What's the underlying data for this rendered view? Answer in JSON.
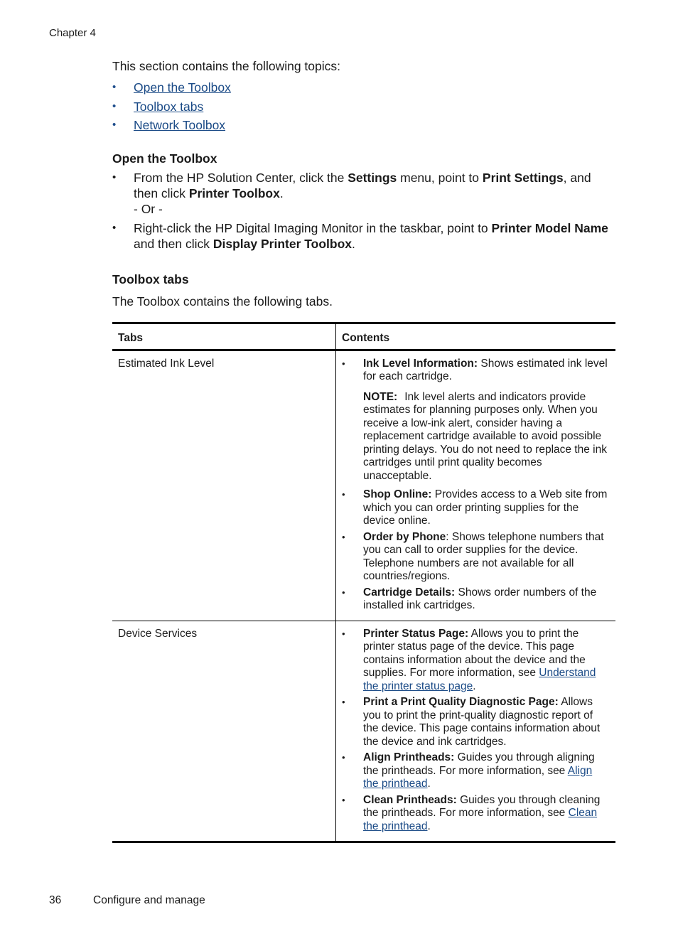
{
  "header": {
    "chapter": "Chapter 4"
  },
  "intro": "This section contains the following topics:",
  "topics": [
    "Open the Toolbox",
    "Toolbox tabs",
    "Network Toolbox"
  ],
  "bullet_char": "•",
  "open_toolbox": {
    "heading": "Open the Toolbox",
    "step1": {
      "t1": "From the HP Solution Center, click the ",
      "b1": "Settings",
      "t2": " menu, point to ",
      "b2": "Print Settings",
      "t3": ", and then click ",
      "b3": "Printer Toolbox",
      "t4": "."
    },
    "or": "- Or -",
    "step2": {
      "t1": "Right-click the HP Digital Imaging Monitor in the taskbar, point to ",
      "b1": "Printer Model Name",
      "t2": " and then click ",
      "b2": "Display Printer Toolbox",
      "t3": "."
    }
  },
  "toolbox_tabs": {
    "heading": "Toolbox tabs",
    "intro": "The Toolbox contains the following tabs.",
    "table": {
      "headers": [
        "Tabs",
        "Contents"
      ],
      "rows": [
        {
          "tab": "Estimated Ink Level",
          "items": [
            {
              "label": "Ink Level Information:",
              "text": " Shows estimated ink level for each cartridge."
            },
            {
              "label": "Shop Online:",
              "text": " Provides access to a Web site from which you can order printing supplies for the device online."
            },
            {
              "label": "Order by Phone",
              "text": ": Shows telephone numbers that you can call to order supplies for the device. Telephone numbers are not available for all countries/regions."
            },
            {
              "label": "Cartridge Details:",
              "text": " Shows order numbers of the installed ink cartridges."
            }
          ],
          "note": {
            "label": "NOTE:",
            "text": "Ink level alerts and indicators provide estimates for planning purposes only. When you receive a low-ink alert, consider having a replacement cartridge available to avoid possible printing delays. You do not need to replace the ink cartridges until print quality becomes unacceptable."
          }
        },
        {
          "tab": "Device Services",
          "items": [
            {
              "label": "Printer Status Page:",
              "text": " Allows you to print the printer status page of the device. This page contains information about the device and the supplies. For more information, see ",
              "link": "Understand the printer status page",
              "end": "."
            },
            {
              "label": "Print a Print Quality Diagnostic Page:",
              "text": " Allows you to print the print-quality diagnostic report of the device. This page contains information about the device and ink cartridges."
            },
            {
              "label": "Align Printheads:",
              "text": " Guides you through aligning the printheads. For more information, see ",
              "link": "Align the printhead",
              "end": "."
            },
            {
              "label": "Clean Printheads:",
              "text": " Guides you through cleaning the printheads. For more information, see ",
              "link": "Clean the printhead",
              "end": "."
            }
          ]
        }
      ]
    }
  },
  "footer": {
    "page_number": "36",
    "section": "Configure and manage"
  },
  "colors": {
    "link": "#1a4a86",
    "text": "#1a1a1a"
  }
}
